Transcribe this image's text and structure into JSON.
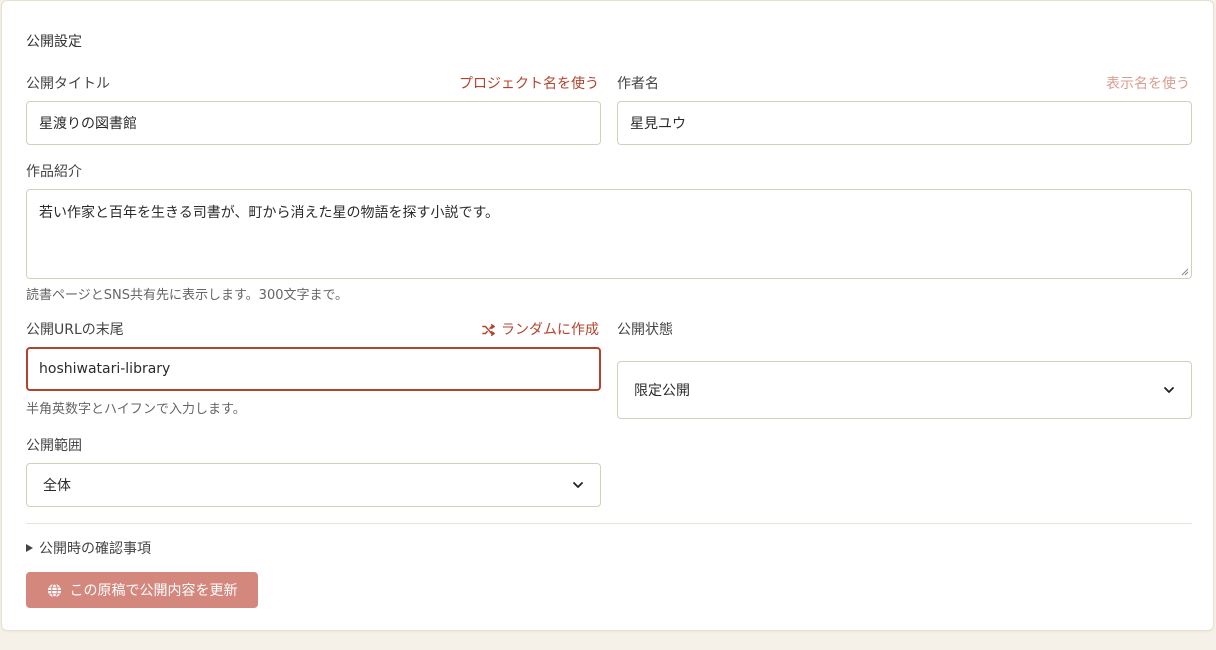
{
  "section_title": "公開設定",
  "title_field": {
    "label": "公開タイトル",
    "action": "プロジェクト名を使う",
    "value": "星渡りの図書館"
  },
  "author_field": {
    "label": "作者名",
    "action": "表示名を使う",
    "value": "星見ユウ"
  },
  "description_field": {
    "label": "作品紹介",
    "value": "若い作家と百年を生きる司書が、町から消えた星の物語を探す小説です。",
    "help": "読書ページとSNS共有先に表示します。300文字まで。"
  },
  "slug_field": {
    "label": "公開URLの末尾",
    "action": "ランダムに作成",
    "value": "hoshiwatari-library",
    "help": "半角英数字とハイフンで入力します。"
  },
  "status_field": {
    "label": "公開状態",
    "selected": "限定公開"
  },
  "scope_field": {
    "label": "公開範囲",
    "selected": "全体"
  },
  "details_summary": "公開時の確認事項",
  "submit_button": {
    "label": "この原稿で公開内容を更新",
    "icon": "globe-icon"
  },
  "colors": {
    "accent": "#b4432e",
    "button_bg": "#d3877d",
    "muted_link": "#d89d8d",
    "page_bg": "#f6f1e8"
  }
}
